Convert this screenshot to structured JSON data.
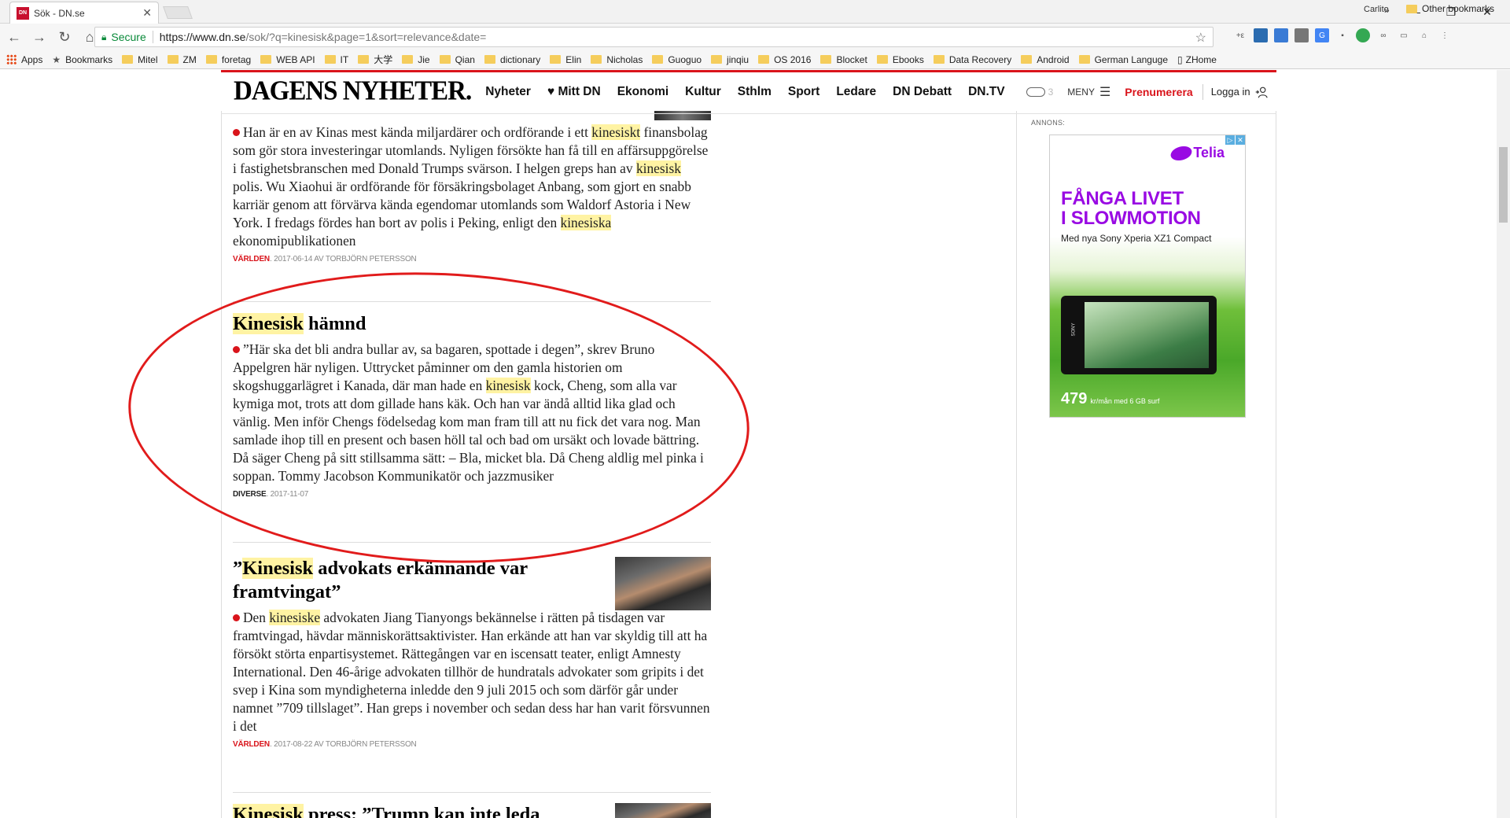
{
  "browser": {
    "tab_title": "Sök - DN.se",
    "favicon_text": "DN",
    "profile_name": "Carlito",
    "secure_label": "Secure",
    "url_host": "https://www.dn.se",
    "url_path": "/sok/?q=kinesisk&page=1&sort=relevance&date=",
    "bookmarks": [
      "Apps",
      "Bookmarks",
      "Mitel",
      "ZM",
      "foretag",
      "WEB API",
      "IT",
      "大学",
      "Jie",
      "Qian",
      "dictionary",
      "Elin",
      "Nicholas",
      "Guoguo",
      "jinqiu",
      "OS 2016",
      "Blocket",
      "Ebooks",
      "Data Recovery",
      "Android",
      "German Languge",
      "ZHome"
    ],
    "bookmarks_more": "»",
    "other_bookmarks": "Other bookmarks"
  },
  "site": {
    "logo": "DAGENS NYHETER.",
    "nav": [
      "Nyheter",
      "♥ Mitt DN",
      "Ekonomi",
      "Kultur",
      "Sthlm",
      "Sport",
      "Ledare",
      "DN Debatt",
      "DN.TV"
    ],
    "weather_temp": "3",
    "menu_label": "MENY",
    "subscribe_label": "Prenumerera",
    "login_label": "Logga in"
  },
  "articles": [
    {
      "segments": [
        {
          "t": "Han är en av Kinas mest kända miljardärer och ordförande i ett "
        },
        {
          "t": "kinesiskt",
          "hl": true
        },
        {
          "t": " finansbolag som gör stora investeringar utomlands. Nyligen försökte han få till en affärsuppgörelse i fastighetsbranschen med Donald Trumps svärson. I helgen greps han av "
        },
        {
          "t": "kinesisk",
          "hl": true
        },
        {
          "t": " polis. Wu Xiaohui är ordförande för försäkringsbolaget Anbang, som gjort en snabb karriär genom att förvärva kända egendomar utomlands som Waldorf Astoria i New York. I fredags fördes han bort av polis i Peking, enligt den "
        },
        {
          "t": "kinesiska",
          "hl": true
        },
        {
          "t": " ekonomipublikationen"
        }
      ],
      "section": "VÄRLDEN",
      "meta_rest": ". 2017-06-14 AV TORBJÖRN PETERSSON"
    },
    {
      "title_hl": "Kinesisk",
      "title_rest": " hämnd",
      "segments": [
        {
          "t": "”Här ska det bli andra bullar av, sa bagaren, spottade i degen”, skrev Bruno Appelgren här nyligen. Uttrycket påminner om den gamla historien om skogshuggarlägret i Kanada, där man hade en "
        },
        {
          "t": "kinesisk",
          "hl": true
        },
        {
          "t": " kock, Cheng, som alla var kymiga mot, trots att dom gillade hans käk. Och han var ändå alltid lika glad och vänlig. Men inför Chengs födelsedag kom man fram till att nu fick det vara nog. Man samlade ihop till en present och basen höll tal och bad om ursäkt och lovade bättring. Då säger Cheng på sitt stillsamma sätt: – Bla, micket bla. Då Cheng aldlig mel pinka i soppan. Tommy Jacobson Kommunikatör och jazzmusiker"
        }
      ],
      "section": "DIVERSE",
      "meta_rest": ". 2017-11-07"
    },
    {
      "title_pre": "”",
      "title_hl": "Kinesisk",
      "title_rest": " advokats erkännande var framtvingat”",
      "segments": [
        {
          "t": "Den "
        },
        {
          "t": "kinesiske",
          "hl": true
        },
        {
          "t": " advokaten Jiang Tianyongs bekännelse i rätten på tisdagen var framtvingad, hävdar människorättsaktivister. Han erkände att han var skyldig till att ha försökt störta enpartisystemet. Rättegången var en iscensatt teater, enligt Amnesty International.  Den 46-årige advokaten tillhör de hundratals advokater som gripits i det svep i Kina som myndigheterna inledde den 9 juli 2015 och som därför går under namnet ”709 tillslaget”. Han greps i november och sedan dess har han varit försvunnen i det"
        }
      ],
      "section": "VÄRLDEN",
      "meta_rest": ". 2017-08-22 AV TORBJÖRN PETERSSON"
    },
    {
      "title_hl": "Kinesisk",
      "title_rest": " press: ”Trump kan inte leda"
    }
  ],
  "ad": {
    "label": "ANNONS:",
    "brand": "Telia",
    "headline_1": "FÅNGA LIVET",
    "headline_2": "I SLOWMOTION",
    "subline": "Med nya Sony Xperia XZ1 Compact",
    "phone_brand": "SONY",
    "price": "479",
    "price_note": "kr/mån med 6 GB surf",
    "close_icons": [
      "▷",
      "✕"
    ]
  }
}
